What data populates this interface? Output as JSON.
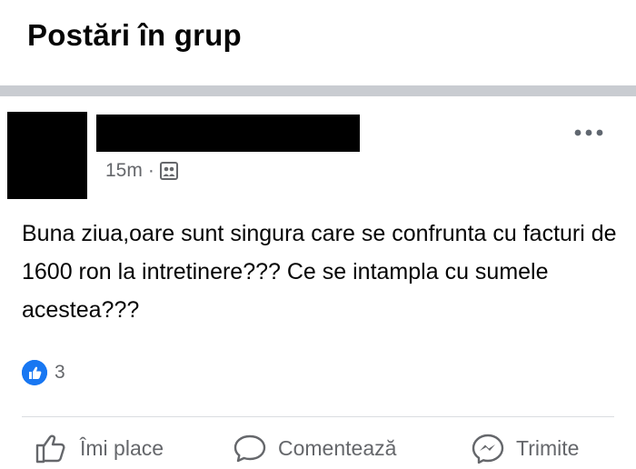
{
  "header": {
    "title": "Postări în grup"
  },
  "post": {
    "time": "15m",
    "separator": "·",
    "text": "Buna ziua,oare sunt singura care se confrunta cu facturi de 1600 ron la intretinere??? Ce se intampla cu sumele acestea???",
    "reactions": {
      "count": "3"
    }
  },
  "actions": {
    "like_label": "Îmi place",
    "comment_label": "Comentează",
    "share_label": "Trimite"
  },
  "colors": {
    "brand_blue": "#1877f2",
    "muted_text": "#65676b",
    "band": "#c9ccd1"
  },
  "icons": [
    "group-privacy-icon",
    "more-options-icon",
    "like-reaction-icon",
    "thumbs-up-icon",
    "comment-icon",
    "messenger-icon"
  ]
}
